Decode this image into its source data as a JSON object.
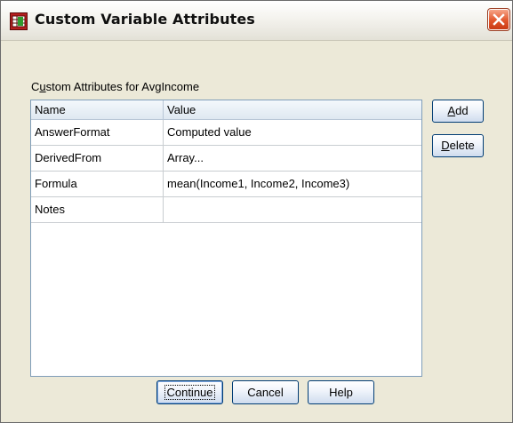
{
  "window": {
    "title": "Custom Variable Attributes",
    "icon": "spss-dialog-icon",
    "close_icon": "close-icon"
  },
  "caption": {
    "prefix": "C",
    "underlined": "u",
    "rest": "stom Attributes for  AvgIncome"
  },
  "table": {
    "headers": [
      "Name",
      "Value"
    ],
    "rows": [
      {
        "name": "AnswerFormat",
        "value": "Computed value"
      },
      {
        "name": "DerivedFrom",
        "value": "Array..."
      },
      {
        "name": "Formula",
        "value": "mean(Income1, Income2, Income3)"
      },
      {
        "name": "Notes",
        "value": ""
      }
    ]
  },
  "side_buttons": {
    "add": {
      "mnemonic": "A",
      "rest": "dd"
    },
    "delete": {
      "mnemonic": "D",
      "rest": "elete"
    }
  },
  "buttons": {
    "continue": "Continue",
    "cancel": "Cancel",
    "help": "Help"
  },
  "colors": {
    "dialog_bg": "#ece9d8",
    "grid_border": "#7f9db9",
    "close_red": "#e2562c",
    "button_border": "#003c74"
  }
}
